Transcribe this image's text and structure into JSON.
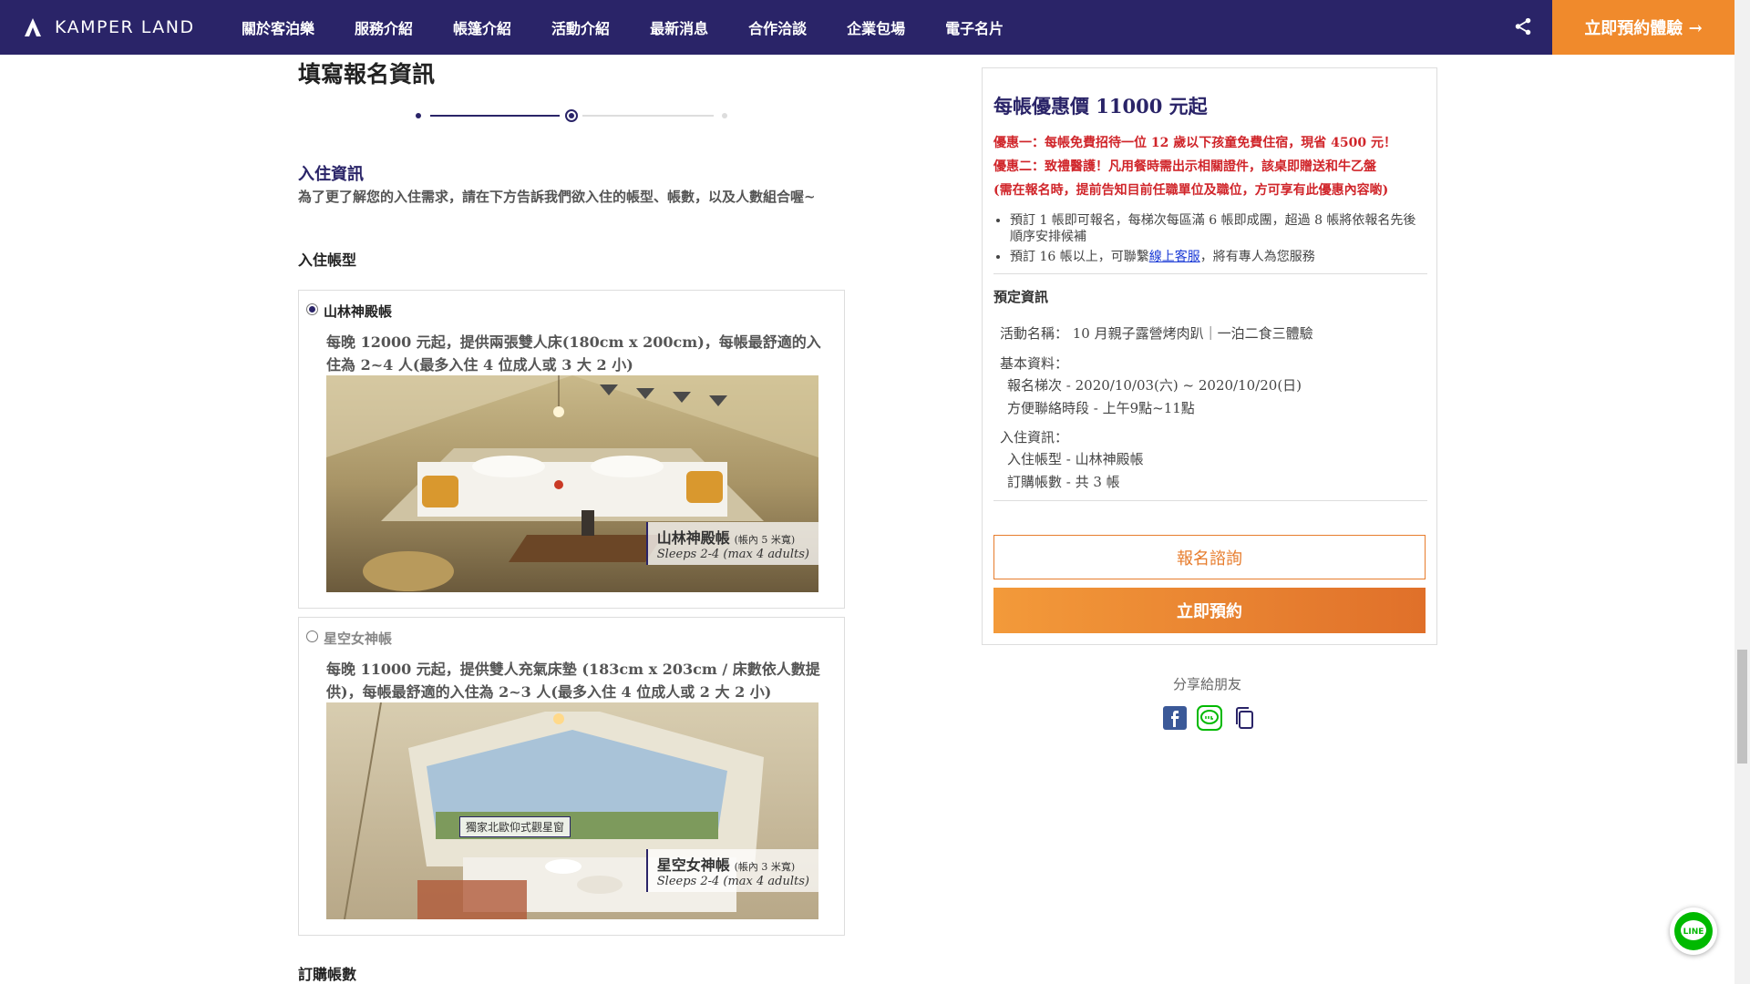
{
  "header": {
    "brand": "KAMPER LAND",
    "nav": [
      "關於客泊樂",
      "服務介紹",
      "帳篷介紹",
      "活動介紹",
      "最新消息",
      "合作洽談",
      "企業包場",
      "電子名片"
    ],
    "cta": "立即預約體驗 →"
  },
  "page_title": "填寫報名資訊",
  "stepper": {
    "current_step": 2,
    "total_steps": 3
  },
  "section": {
    "title": "入住資訊",
    "description": "為了更了解您的入住需求，請在下方告訴我們欲入住的帳型、帳數，以及人數組合喔~",
    "tent_label": "入住帳型",
    "count_label": "訂購帳數"
  },
  "tents": [
    {
      "name": "山林神殿帳",
      "selected": true,
      "desc": "每晚 12000 元起，提供兩張雙人床(180cm x 200cm)，每帳最舒適的入住為 2~4 人(最多入住 4 位成人或 3 大 2 小)",
      "caption_cn": "山林神殿帳",
      "caption_small": "(帳內 5 米寬)",
      "caption_en": "Sleeps 2-4 (max 4 adults)"
    },
    {
      "name": "星空女神帳",
      "selected": false,
      "desc": "每晚 11000 元起，提供雙人充氣床墊 (183cm x 203cm / 床數依人數提供)，每帳最舒適的入住為 2~3 人(最多入住 4 位成人或 2 大 2 小)",
      "caption_cn": "星空女神帳",
      "caption_small": "(帳內 3 米寬)",
      "caption_en": "Sleeps 2-4 (max 4 adults)",
      "window_label": "獨家北歐仰式觀星窗"
    }
  ],
  "panel": {
    "price": "每帳優惠價 11000 元起",
    "offer1": "優惠一：每帳免費招待一位 12 歲以下孩童免費住宿，現省 4500 元！",
    "offer2": "優惠二：致禮醫護！凡用餐時需出示相關證件，該桌即贈送和牛乙盤",
    "offer2_note": "(需在報名時，提前告知目前任職單位及職位，方可享有此優惠內容喲)",
    "bullets": [
      "預訂 1 帳即可報名，每梯次每區滿 6 帳即成團，超過 8 帳將依報名先後順序安排候補",
      "預訂 16 帳以上，可聯繫"
    ],
    "bullet2_link": "線上客服",
    "bullet2_tail": "，將有專人為您服務",
    "info_title": "預定資訊",
    "activity": "活動名稱： 10 月親子露營烤肉趴｜一泊二食三體驗",
    "basic_label": "基本資料：",
    "session": "報名梯次 - 2020/10/03(六) ~ 2020/10/20(日)",
    "contact_time": "方便聯絡時段 - 上午9點~11點",
    "stay_label": "入住資訊：",
    "tent_type": "入住帳型 - 山林神殿帳",
    "tent_count": "訂購帳數 - 共 3 帳",
    "btn_inquiry": "報名諮詢",
    "btn_book": "立即預約"
  },
  "share": {
    "label": "分享給朋友"
  },
  "colors": {
    "brand": "#2a2468",
    "accent": "#f08a2c",
    "offer": "#d0252a"
  }
}
